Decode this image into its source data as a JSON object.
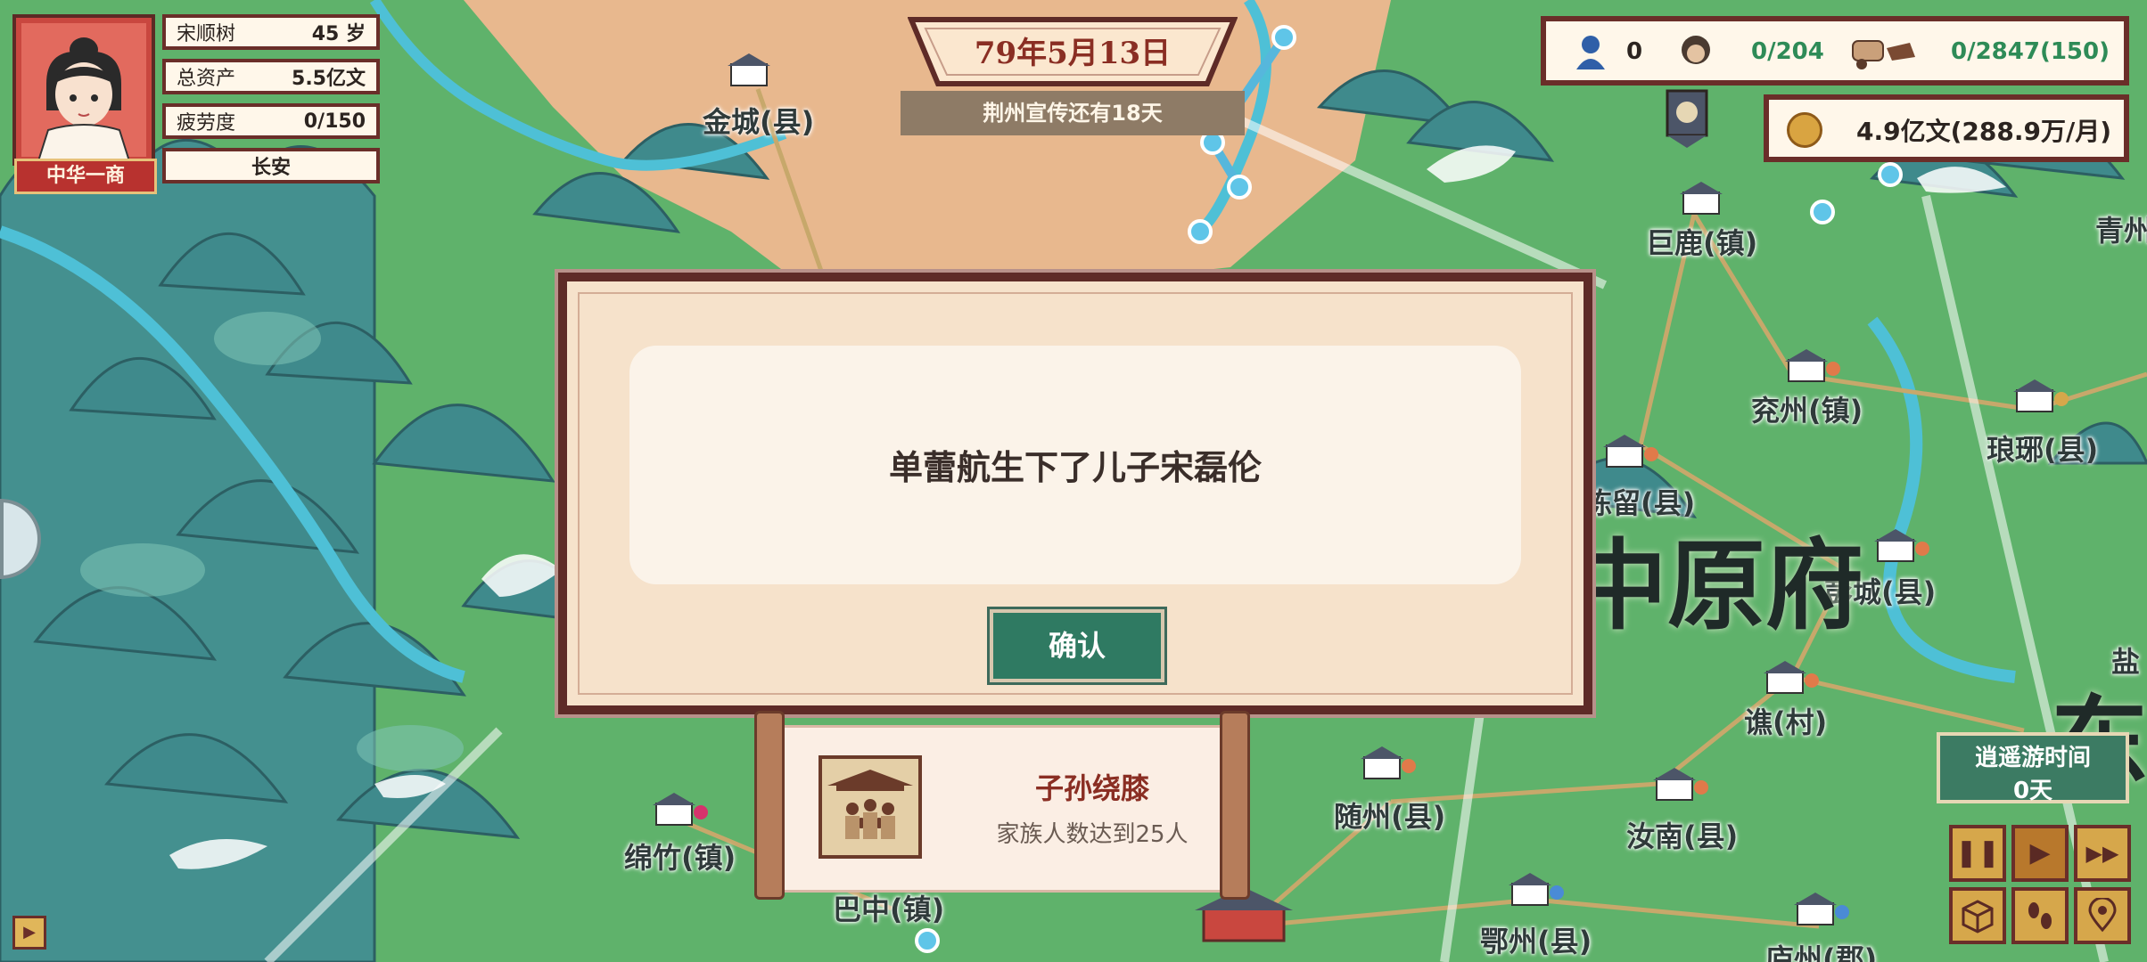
{
  "player": {
    "name": "宋顺树",
    "age": "45 岁",
    "assets_label": "总资产",
    "assets_value": "5.5亿文",
    "fatigue_label": "疲劳度",
    "fatigue_value": "0/150",
    "location": "长安",
    "title_badge": "中华一商"
  },
  "date": {
    "text": "79年5月13日",
    "promo": "荆州宣传还有18天"
  },
  "resources": {
    "scholars": "0",
    "workers": "0/204",
    "caravans": "0/2847(150)",
    "money": "4.9亿文(288.9万/月)"
  },
  "dialog": {
    "message": "单蕾航生下了儿子宋磊伦",
    "confirm_label": "确认"
  },
  "achievement": {
    "title": "子孙绕膝",
    "description": "家族人数达到25人"
  },
  "map": {
    "region_name": "中原府",
    "region_partial": "东",
    "cities": {
      "jincheng": "金城(县)",
      "julu": "巨鹿(镇)",
      "qingzhou": "青州",
      "yanzhou": "兖州(镇)",
      "langya": "琅琊(县)",
      "chenliu": "陈留(县)",
      "pengcheng": "彭城(县)",
      "qiao": "谯(村)",
      "suizhou": "随州(县)",
      "runan": "汝南(县)",
      "mianzhu": "绵竹(镇)",
      "bazhong": "巴中(镇)",
      "ezhou": "鄂州(县)",
      "luzhou": "庐州(郡)",
      "yan": "盐"
    }
  },
  "controls": {
    "free_time_label": "逍遥游时间",
    "free_time_value": "0天",
    "pause": "❚❚",
    "play": "▶",
    "fast": "▶▶"
  },
  "colors": {
    "frame": "#5e2b27",
    "accent_green": "#2f7a62",
    "title_red": "#8a2e23",
    "worker_green": "#2e8b57"
  }
}
